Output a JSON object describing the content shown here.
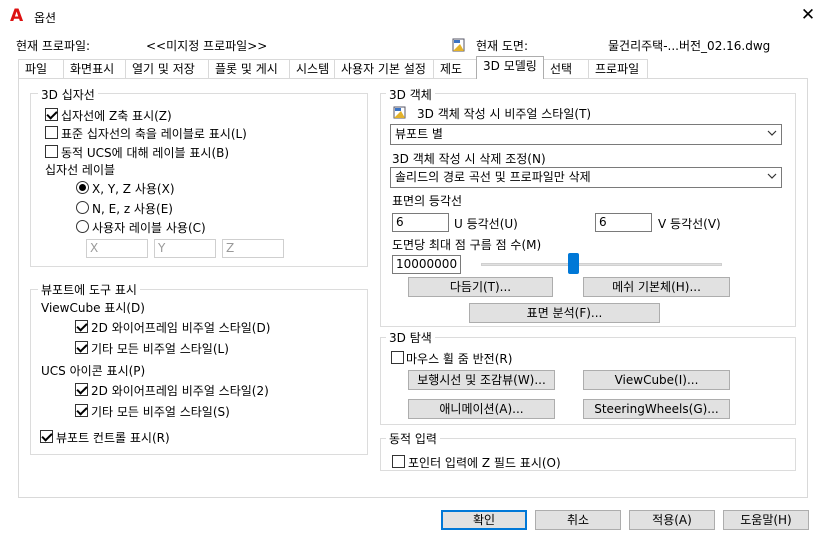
{
  "window": {
    "title": "옵션",
    "app_icon": "autocad-a-icon",
    "close_glyph": "✕"
  },
  "header": {
    "profile_label": "현재 프로파일:",
    "profile_value": "<<미지정 프로파일>>",
    "drawing_label": "현재 도면:",
    "drawing_value": "물건리주택-...버전_02.16.dwg"
  },
  "tabs": [
    "파일",
    "화면표시",
    "열기 및 저장",
    "플롯 및 게시",
    "시스템",
    "사용자 기본 설정",
    "제도",
    "3D 모델링",
    "선택",
    "프로파일"
  ],
  "active_tab": "3D 모델링",
  "crosshair": {
    "group_label": "3D 십자선",
    "show_z": "십자선에 Z축 표시(Z)",
    "label_axes": "표준 십자선의 축을 레이블로 표시(L)",
    "dynamic_ucs": "동적 UCS에 대해 레이블 표시(B)",
    "labels_title": "십자선 레이블",
    "radio_xyz": "X, Y, Z 사용(X)",
    "radio_nez": "N, E, z 사용(E)",
    "radio_custom": "사용자 레이블 사용(C)",
    "custom_x": "X",
    "custom_y": "Y",
    "custom_z": "Z"
  },
  "viewport_tools": {
    "group_label": "뷰포트에 도구 표시",
    "viewcube_title": "ViewCube 표시(D)",
    "vc_2d": "2D 와이어프레임 비주얼 스타일(D)",
    "vc_other": "기타 모든 비주얼 스타일(L)",
    "ucs_title": "UCS 아이콘 표시(P)",
    "ucs_2d": "2D 와이어프레임 비주얼 스타일(2)",
    "ucs_other": "기타 모든 비주얼 스타일(S)",
    "viewport_controls": "뷰포트 컨트롤 표시(R)"
  },
  "objects3d": {
    "group_label": "3D 객체",
    "visual_style_label": "3D 객체 작성 시 비주얼 스타일(T)",
    "visual_style_value": "뷰포트 별",
    "deletion_label": "3D 객체 작성 시 삭제 조정(N)",
    "deletion_value": "솔리드의 경로 곡선 및 프로파일만 삭제",
    "isolines_title": "표면의 등각선",
    "u_value": "6",
    "u_label": "U 등각선(U)",
    "v_value": "6",
    "v_label": "V 등각선(V)",
    "max_points_label": "도면당 최대 점 구름 점 수(M)",
    "max_points_value": "10000000",
    "slider_fraction": 0.38,
    "btn_tessellation": "다듬기(T)...",
    "btn_mesh": "메쉬 기본체(H)...",
    "btn_surface": "표면 분석(F)..."
  },
  "navigation3d": {
    "group_label": "3D 탐색",
    "reverse_zoom": "마우스 휠 줌 반전(R)",
    "btn_walk": "보행시선 및 조감뷰(W)...",
    "btn_viewcube": "ViewCube(I)...",
    "btn_animation": "애니메이션(A)...",
    "btn_steering": "SteeringWheels(G)..."
  },
  "dynamic_input": {
    "group_label": "동적 입력",
    "z_field": "포인터 입력에 Z 필드 표시(O)"
  },
  "footer": {
    "ok": "확인",
    "cancel": "취소",
    "apply": "적용(A)",
    "help": "도움말(H)"
  },
  "colors": {
    "accent": "#0078d7",
    "app_icon": "#d11111",
    "border": "#d9d9d9"
  }
}
